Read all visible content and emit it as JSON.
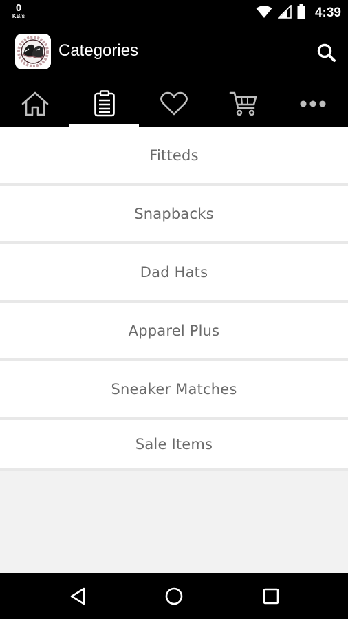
{
  "status_bar": {
    "data_rate_value": "0",
    "data_rate_unit": "KB/s",
    "time": "4:39"
  },
  "app_bar": {
    "title": "Categories",
    "logo_icon": "hat-brand-logo",
    "search_icon": "search-icon"
  },
  "tabs": [
    {
      "name": "home",
      "icon": "home-icon",
      "active": false
    },
    {
      "name": "categories",
      "icon": "clipboard-list-icon",
      "active": true
    },
    {
      "name": "wishlist",
      "icon": "heart-icon",
      "active": false
    },
    {
      "name": "cart",
      "icon": "cart-icon",
      "active": false
    },
    {
      "name": "more",
      "icon": "more-icon",
      "active": false
    }
  ],
  "categories": [
    {
      "label": "Fitteds"
    },
    {
      "label": "Snapbacks"
    },
    {
      "label": "Dad Hats"
    },
    {
      "label": "Apparel Plus"
    },
    {
      "label": "Sneaker Matches"
    },
    {
      "label": "Sale Items"
    }
  ],
  "colors": {
    "bar_background": "#000000",
    "list_background": "#ffffff",
    "page_background": "#f2f2f2",
    "text_gray": "#6a6a6a"
  }
}
